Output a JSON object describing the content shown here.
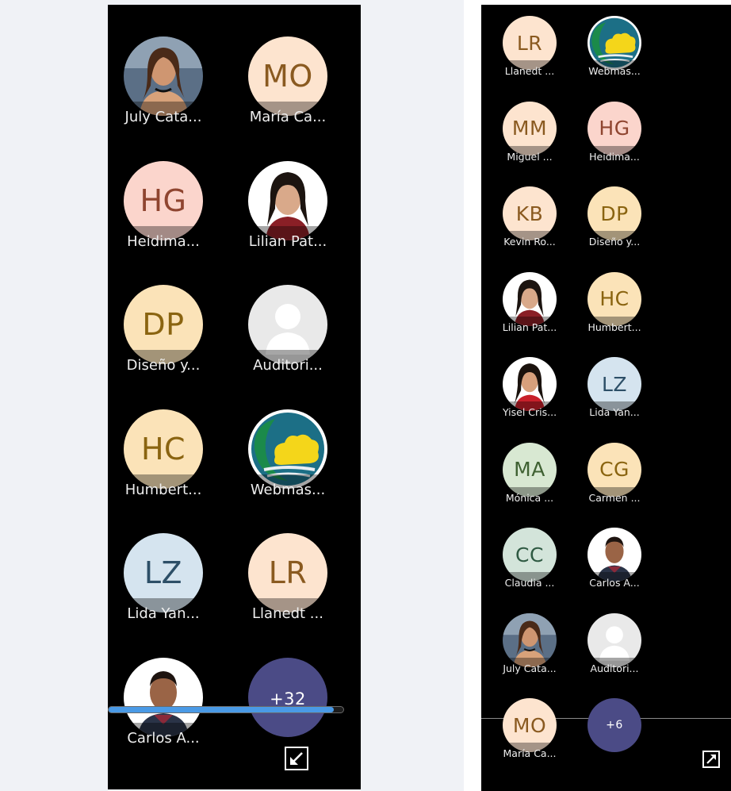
{
  "colors": {
    "page_background": "#f0f2f6",
    "panel_background": "#000000",
    "more_tile": "#4b4b86",
    "progress_fill": "#4a9ae6"
  },
  "left_panel": {
    "participants": [
      {
        "name": "July Cata...",
        "initials": "",
        "kind": "photo-woman-glasses"
      },
      {
        "name": "María Ca...",
        "initials": "MO",
        "kind": "initials",
        "bg": "#fde4cf",
        "fg": "#8a5a20"
      },
      {
        "name": "Heidima...",
        "initials": "HG",
        "kind": "initials",
        "bg": "#fbd5cc",
        "fg": "#8f4530"
      },
      {
        "name": "Lilian Pat...",
        "initials": "",
        "kind": "photo-woman"
      },
      {
        "name": "Diseño y...",
        "initials": "DP",
        "kind": "initials",
        "bg": "#fbe3b8",
        "fg": "#8a6410"
      },
      {
        "name": "Auditori...",
        "initials": "",
        "kind": "default-silhouette"
      },
      {
        "name": "Humbert...",
        "initials": "HC",
        "kind": "initials",
        "bg": "#fbe3b8",
        "fg": "#8a6410"
      },
      {
        "name": "Webmas...",
        "initials": "",
        "kind": "logo"
      },
      {
        "name": "Lida Yan...",
        "initials": "LZ",
        "kind": "initials",
        "bg": "#d5e4ef",
        "fg": "#2d4f67"
      },
      {
        "name": "Llanedt ...",
        "initials": "LR",
        "kind": "initials",
        "bg": "#fde4cf",
        "fg": "#8a5a20"
      },
      {
        "name": "Carlos A...",
        "initials": "",
        "kind": "photo-man"
      }
    ],
    "more_count": "+32",
    "progress": 0.96,
    "corner_icon": "collapse-arrow-icon"
  },
  "right_panel": {
    "participants": [
      {
        "name": "Llanedt ...",
        "initials": "LR",
        "kind": "initials",
        "bg": "#fde4cf",
        "fg": "#8a5a20"
      },
      {
        "name": "Webmas...",
        "initials": "",
        "kind": "logo"
      },
      {
        "name": "Miguel ...",
        "initials": "MM",
        "kind": "initials",
        "bg": "#fde4cf",
        "fg": "#8a5a20"
      },
      {
        "name": "Heidima...",
        "initials": "HG",
        "kind": "initials",
        "bg": "#fbd5cc",
        "fg": "#8f4530"
      },
      {
        "name": "Kevin Ro...",
        "initials": "KB",
        "kind": "initials",
        "bg": "#fde4cf",
        "fg": "#8a5a20"
      },
      {
        "name": "Diseño y...",
        "initials": "DP",
        "kind": "initials",
        "bg": "#fbe3b8",
        "fg": "#8a6410"
      },
      {
        "name": "Lilian Pat...",
        "initials": "",
        "kind": "photo-woman"
      },
      {
        "name": "Humbert...",
        "initials": "HC",
        "kind": "initials",
        "bg": "#fbe3b8",
        "fg": "#8a6410"
      },
      {
        "name": "Yisel Cris...",
        "initials": "",
        "kind": "photo-woman-red"
      },
      {
        "name": "Lida Yan...",
        "initials": "LZ",
        "kind": "initials",
        "bg": "#d5e4ef",
        "fg": "#2d4f67"
      },
      {
        "name": "Mónica ...",
        "initials": "MA",
        "kind": "initials",
        "bg": "#d8e8d2",
        "fg": "#3f6132"
      },
      {
        "name": "Carmen ...",
        "initials": "CG",
        "kind": "initials",
        "bg": "#fbe3b8",
        "fg": "#8a6410"
      },
      {
        "name": "Claudia ...",
        "initials": "CC",
        "kind": "initials",
        "bg": "#d3e4da",
        "fg": "#2f5a43"
      },
      {
        "name": "Carlos A...",
        "initials": "",
        "kind": "photo-man"
      },
      {
        "name": "July Cata...",
        "initials": "",
        "kind": "photo-woman-glasses"
      },
      {
        "name": "Auditori...",
        "initials": "",
        "kind": "default-silhouette"
      },
      {
        "name": "María Ca...",
        "initials": "MO",
        "kind": "initials",
        "bg": "#fde4cf",
        "fg": "#8a5a20"
      }
    ],
    "more_count": "+6",
    "corner_icon": "expand-arrow-icon"
  }
}
